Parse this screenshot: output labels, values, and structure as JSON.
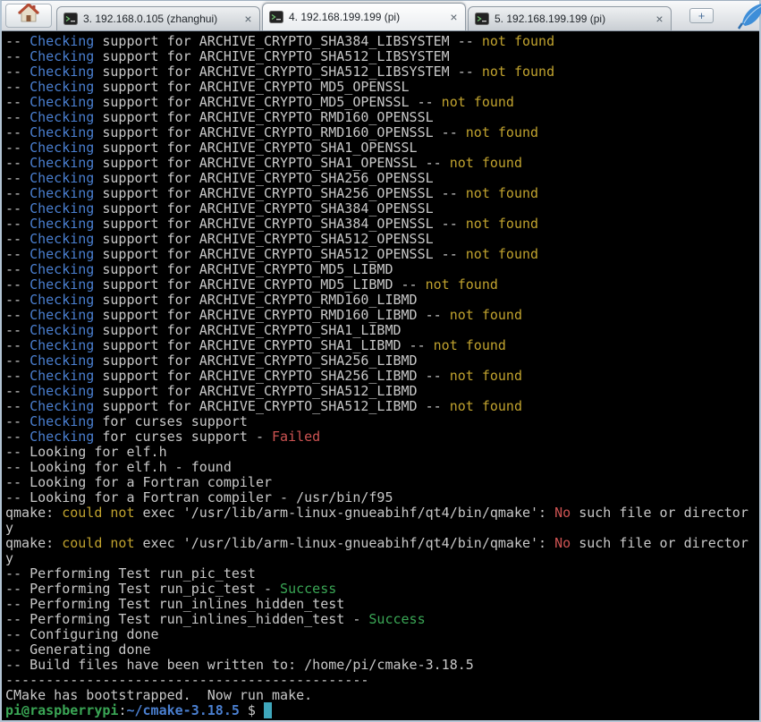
{
  "tabbar": {
    "tabs": [
      {
        "label": "3. 192.168.0.105 (zhanghui)",
        "close_glyph": "×"
      },
      {
        "label": "4. 192.168.199.199 (pi)",
        "close_glyph": "×"
      },
      {
        "label": "5. 192.168.199.199 (pi)",
        "close_glyph": "×"
      }
    ],
    "new_tab_glyph": "+"
  },
  "terminal": {
    "styles": {
      "d": {
        "color": "#c8c8c8"
      },
      "b": {
        "color": "#4a7fd0"
      },
      "y": {
        "color": "#c0a22e"
      },
      "r": {
        "color": "#cd5352"
      },
      "g": {
        "color": "#3aa655"
      },
      "pg": {
        "color": "#3aa655",
        "bold": true
      },
      "pb": {
        "color": "#4a7fd0",
        "bold": true
      },
      "cur": {
        "color": "#000000",
        "bg": "#3fa7bc"
      }
    },
    "lines": [
      [
        [
          "d",
          "-- "
        ],
        [
          "b",
          "Checking"
        ],
        [
          "d",
          " support for ARCHIVE_CRYPTO_SHA384_LIBSYSTEM -- "
        ],
        [
          "y",
          "not found"
        ]
      ],
      [
        [
          "d",
          "-- "
        ],
        [
          "b",
          "Checking"
        ],
        [
          "d",
          " support for ARCHIVE_CRYPTO_SHA512_LIBSYSTEM"
        ]
      ],
      [
        [
          "d",
          "-- "
        ],
        [
          "b",
          "Checking"
        ],
        [
          "d",
          " support for ARCHIVE_CRYPTO_SHA512_LIBSYSTEM -- "
        ],
        [
          "y",
          "not found"
        ]
      ],
      [
        [
          "d",
          "-- "
        ],
        [
          "b",
          "Checking"
        ],
        [
          "d",
          " support for ARCHIVE_CRYPTO_MD5_OPENSSL"
        ]
      ],
      [
        [
          "d",
          "-- "
        ],
        [
          "b",
          "Checking"
        ],
        [
          "d",
          " support for ARCHIVE_CRYPTO_MD5_OPENSSL -- "
        ],
        [
          "y",
          "not found"
        ]
      ],
      [
        [
          "d",
          "-- "
        ],
        [
          "b",
          "Checking"
        ],
        [
          "d",
          " support for ARCHIVE_CRYPTO_RMD160_OPENSSL"
        ]
      ],
      [
        [
          "d",
          "-- "
        ],
        [
          "b",
          "Checking"
        ],
        [
          "d",
          " support for ARCHIVE_CRYPTO_RMD160_OPENSSL -- "
        ],
        [
          "y",
          "not found"
        ]
      ],
      [
        [
          "d",
          "-- "
        ],
        [
          "b",
          "Checking"
        ],
        [
          "d",
          " support for ARCHIVE_CRYPTO_SHA1_OPENSSL"
        ]
      ],
      [
        [
          "d",
          "-- "
        ],
        [
          "b",
          "Checking"
        ],
        [
          "d",
          " support for ARCHIVE_CRYPTO_SHA1_OPENSSL -- "
        ],
        [
          "y",
          "not found"
        ]
      ],
      [
        [
          "d",
          "-- "
        ],
        [
          "b",
          "Checking"
        ],
        [
          "d",
          " support for ARCHIVE_CRYPTO_SHA256_OPENSSL"
        ]
      ],
      [
        [
          "d",
          "-- "
        ],
        [
          "b",
          "Checking"
        ],
        [
          "d",
          " support for ARCHIVE_CRYPTO_SHA256_OPENSSL -- "
        ],
        [
          "y",
          "not found"
        ]
      ],
      [
        [
          "d",
          "-- "
        ],
        [
          "b",
          "Checking"
        ],
        [
          "d",
          " support for ARCHIVE_CRYPTO_SHA384_OPENSSL"
        ]
      ],
      [
        [
          "d",
          "-- "
        ],
        [
          "b",
          "Checking"
        ],
        [
          "d",
          " support for ARCHIVE_CRYPTO_SHA384_OPENSSL -- "
        ],
        [
          "y",
          "not found"
        ]
      ],
      [
        [
          "d",
          "-- "
        ],
        [
          "b",
          "Checking"
        ],
        [
          "d",
          " support for ARCHIVE_CRYPTO_SHA512_OPENSSL"
        ]
      ],
      [
        [
          "d",
          "-- "
        ],
        [
          "b",
          "Checking"
        ],
        [
          "d",
          " support for ARCHIVE_CRYPTO_SHA512_OPENSSL -- "
        ],
        [
          "y",
          "not found"
        ]
      ],
      [
        [
          "d",
          "-- "
        ],
        [
          "b",
          "Checking"
        ],
        [
          "d",
          " support for ARCHIVE_CRYPTO_MD5_LIBMD"
        ]
      ],
      [
        [
          "d",
          "-- "
        ],
        [
          "b",
          "Checking"
        ],
        [
          "d",
          " support for ARCHIVE_CRYPTO_MD5_LIBMD -- "
        ],
        [
          "y",
          "not found"
        ]
      ],
      [
        [
          "d",
          "-- "
        ],
        [
          "b",
          "Checking"
        ],
        [
          "d",
          " support for ARCHIVE_CRYPTO_RMD160_LIBMD"
        ]
      ],
      [
        [
          "d",
          "-- "
        ],
        [
          "b",
          "Checking"
        ],
        [
          "d",
          " support for ARCHIVE_CRYPTO_RMD160_LIBMD -- "
        ],
        [
          "y",
          "not found"
        ]
      ],
      [
        [
          "d",
          "-- "
        ],
        [
          "b",
          "Checking"
        ],
        [
          "d",
          " support for ARCHIVE_CRYPTO_SHA1_LIBMD"
        ]
      ],
      [
        [
          "d",
          "-- "
        ],
        [
          "b",
          "Checking"
        ],
        [
          "d",
          " support for ARCHIVE_CRYPTO_SHA1_LIBMD -- "
        ],
        [
          "y",
          "not found"
        ]
      ],
      [
        [
          "d",
          "-- "
        ],
        [
          "b",
          "Checking"
        ],
        [
          "d",
          " support for ARCHIVE_CRYPTO_SHA256_LIBMD"
        ]
      ],
      [
        [
          "d",
          "-- "
        ],
        [
          "b",
          "Checking"
        ],
        [
          "d",
          " support for ARCHIVE_CRYPTO_SHA256_LIBMD -- "
        ],
        [
          "y",
          "not found"
        ]
      ],
      [
        [
          "d",
          "-- "
        ],
        [
          "b",
          "Checking"
        ],
        [
          "d",
          " support for ARCHIVE_CRYPTO_SHA512_LIBMD"
        ]
      ],
      [
        [
          "d",
          "-- "
        ],
        [
          "b",
          "Checking"
        ],
        [
          "d",
          " support for ARCHIVE_CRYPTO_SHA512_LIBMD -- "
        ],
        [
          "y",
          "not found"
        ]
      ],
      [
        [
          "d",
          "-- "
        ],
        [
          "b",
          "Checking"
        ],
        [
          "d",
          " for curses support"
        ]
      ],
      [
        [
          "d",
          "-- "
        ],
        [
          "b",
          "Checking"
        ],
        [
          "d",
          " for curses support - "
        ],
        [
          "r",
          "Failed"
        ]
      ],
      [
        [
          "d",
          "-- Looking for elf.h"
        ]
      ],
      [
        [
          "d",
          "-- Looking for elf.h - found"
        ]
      ],
      [
        [
          "d",
          "-- Looking for a Fortran compiler"
        ]
      ],
      [
        [
          "d",
          "-- Looking for a Fortran compiler - /usr/bin/f95"
        ]
      ],
      [
        [
          "d",
          "qmake: "
        ],
        [
          "y",
          "could not"
        ],
        [
          "d",
          " exec '/usr/lib/arm-linux-gnueabihf/qt4/bin/qmake': "
        ],
        [
          "r",
          "No"
        ],
        [
          "d",
          " such file or director"
        ]
      ],
      [
        [
          "d",
          "y"
        ]
      ],
      [
        [
          "d",
          "qmake: "
        ],
        [
          "y",
          "could not"
        ],
        [
          "d",
          " exec '/usr/lib/arm-linux-gnueabihf/qt4/bin/qmake': "
        ],
        [
          "r",
          "No"
        ],
        [
          "d",
          " such file or director"
        ]
      ],
      [
        [
          "d",
          "y"
        ]
      ],
      [
        [
          "d",
          "-- Performing Test run_pic_test"
        ]
      ],
      [
        [
          "d",
          "-- Performing Test run_pic_test - "
        ],
        [
          "g",
          "Success"
        ]
      ],
      [
        [
          "d",
          "-- Performing Test run_inlines_hidden_test"
        ]
      ],
      [
        [
          "d",
          "-- Performing Test run_inlines_hidden_test - "
        ],
        [
          "g",
          "Success"
        ]
      ],
      [
        [
          "d",
          "-- Configuring done"
        ]
      ],
      [
        [
          "d",
          "-- Generating done"
        ]
      ],
      [
        [
          "d",
          "-- Build files have been written to: /home/pi/cmake-3.18.5"
        ]
      ],
      [
        [
          "d",
          "---------------------------------------------"
        ]
      ],
      [
        [
          "d",
          "CMake has bootstrapped.  Now run make."
        ]
      ],
      [
        [
          "pg",
          "pi@raspberrypi"
        ],
        [
          "d",
          ":"
        ],
        [
          "pb",
          "~/cmake-3.18.5"
        ],
        [
          "d",
          " $ "
        ],
        [
          "cur",
          " "
        ]
      ]
    ]
  }
}
